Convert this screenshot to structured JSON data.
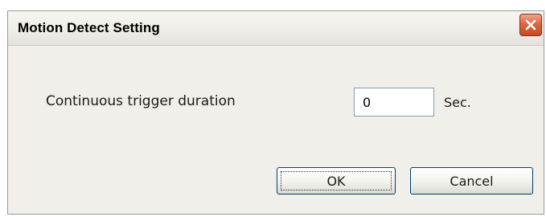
{
  "window": {
    "title": "Motion Detect Setting",
    "close_icon": "close-icon"
  },
  "form": {
    "duration_label": "Continuous trigger duration",
    "duration_value": "0",
    "duration_unit": "Sec."
  },
  "buttons": {
    "ok_label": "OK",
    "cancel_label": "Cancel"
  },
  "colors": {
    "close_button": "#d8552f",
    "dialog_background": "#f0efea"
  }
}
